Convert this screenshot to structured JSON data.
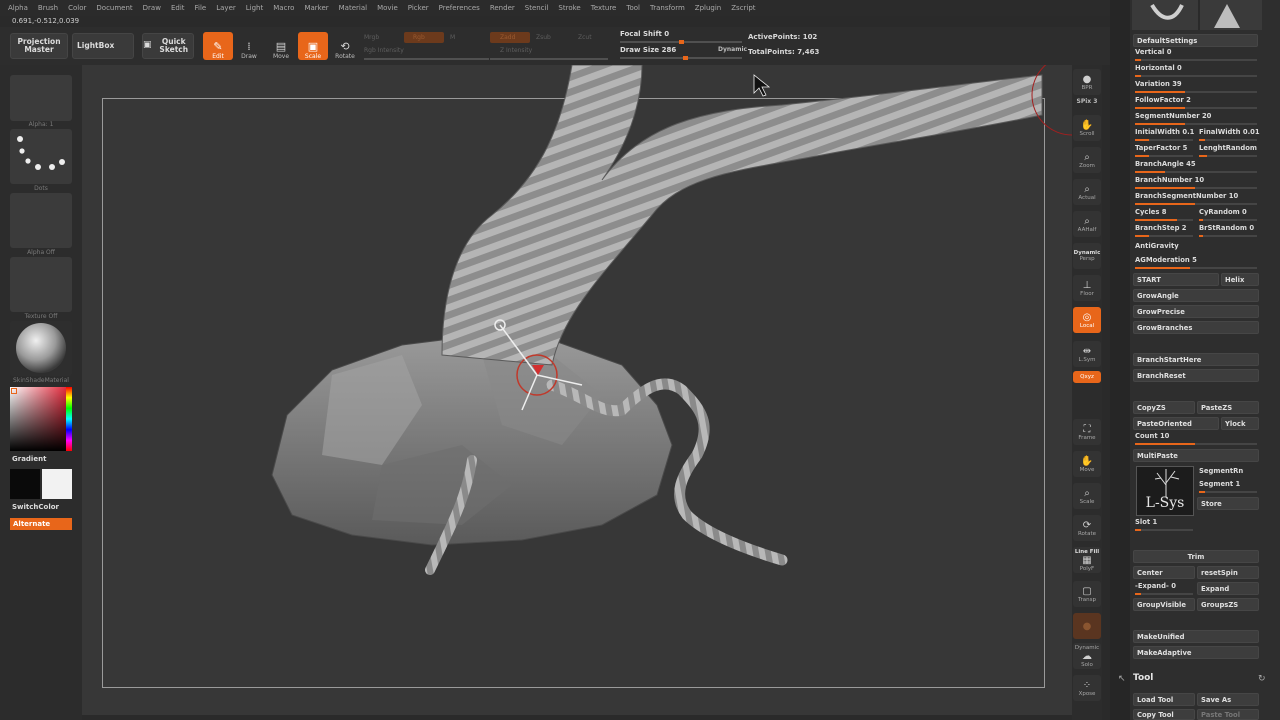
{
  "menu": [
    "Alpha",
    "Brush",
    "Color",
    "Document",
    "Draw",
    "Edit",
    "File",
    "Layer",
    "Light",
    "Macro",
    "Marker",
    "Material",
    "Movie",
    "Picker",
    "Preferences",
    "Render",
    "Stencil",
    "Stroke",
    "Texture",
    "Tool",
    "Transform",
    "Zplugin",
    "Zscript"
  ],
  "coords": "0.691,-0.512,0.039",
  "toolbar": {
    "projection_master": "Projection Master",
    "lightbox": "LightBox",
    "quick_sketch": "Quick Sketch",
    "edit": "Edit",
    "draw": "Draw",
    "move": "Move",
    "scale": "Scale",
    "rotate": "Rotate",
    "mrgb": "Mrgb",
    "rgb": "Rgb",
    "m": "M",
    "zadd": "Zadd",
    "zsub": "Zsub",
    "zcut": "Zcut",
    "rgb_intensity": "Rgb Intensity",
    "z_intensity": "Z Intensity",
    "focal_shift": "Focal Shift 0",
    "draw_size": "Draw Size 286",
    "dynamic": "Dynamic",
    "active_points": "ActivePoints: 102",
    "total_points": "TotalPoints: 7,463"
  },
  "left": {
    "alpha_label": "Alpha: 1",
    "brush_label": "Dots",
    "alpha_off": "Alpha Off",
    "texture_off": "Texture Off",
    "material_label": "SkinShadeMaterial",
    "gradient": "Gradient",
    "switch_color": "SwitchColor",
    "alternate": "Alternate"
  },
  "right_shelf": {
    "bpr": "BPR",
    "spix": "SPix 3",
    "scroll": "Scroll",
    "zoom": "Zoom",
    "actual": "Actual",
    "aahalf": "AAHalf",
    "dynamic": "Dynamic",
    "persp": "Persp",
    "floor": "Floor",
    "local": "Local",
    "lsym": "L.Sym",
    "xyz": "Qxyz",
    "frame": "Frame",
    "move": "Move",
    "scale": "Scale",
    "rotate": "Rotate",
    "line_fill": "Line Fill",
    "polyf": "PolyF",
    "transp": "Transp",
    "dynamic2": "Dynamic",
    "solo": "Solo",
    "xpose": "Xpose"
  },
  "tray": {
    "default_settings": "DefaultSettings",
    "vertical": "Vertical 0",
    "horizontal": "Horizontal 0",
    "variation": "Variation 39",
    "follow_factor": "FollowFactor 2",
    "segment_number": "SegmentNumber 20",
    "initial_width": "InitialWidth 0.1",
    "final_width": "FinalWidth 0.01",
    "taper_factor": "TaperFactor 5",
    "lenght_random": "LenghtRandom",
    "branch_angle": "BranchAngle 45",
    "branch_number": "BranchNumber 10",
    "branch_segment_number": "BranchSegmentNumber 10",
    "cycles": "Cycles 8",
    "cy_random": "CyRandom 0",
    "branch_step": "BranchStep 2",
    "brst_random": "BrStRandom 0",
    "anti_gravity": "AntiGravity",
    "ag_moderation": "AGModeration 5",
    "start": "START",
    "helix": "Helix",
    "grow_angle": "GrowAngle",
    "grow_precise": "GrowPrecise",
    "grow_branches": "GrowBranches",
    "branch_start_here": "BranchStartHere",
    "branch_reset": "BranchReset",
    "copy_zs": "CopyZS",
    "paste_zs": "PasteZS",
    "paste_oriented": "PasteOriented",
    "ylock": "Ylock",
    "count": "Count 10",
    "multi_paste": "MultiPaste",
    "segment_rn": "SegmentRn",
    "segment": "Segment 1",
    "store": "Store",
    "lsys": "L-Sys",
    "slot": "Slot 1",
    "trim": "Trim",
    "center": "Center",
    "reset_spin": "resetSpin",
    "expand_value": "-Expand- 0",
    "expand": "Expand",
    "group_visible": "GroupVisible",
    "groups_zs": "GroupsZS",
    "make_unified": "MakeUnified",
    "make_adaptive": "MakeAdaptive",
    "tool": "Tool",
    "load_tool": "Load Tool",
    "save_as": "Save As",
    "copy_tool": "Copy Tool",
    "paste_tool": "Paste Tool"
  },
  "colors": {
    "accent": "#e8661a",
    "panel": "#2e2e2e",
    "viewport": "#373737"
  }
}
